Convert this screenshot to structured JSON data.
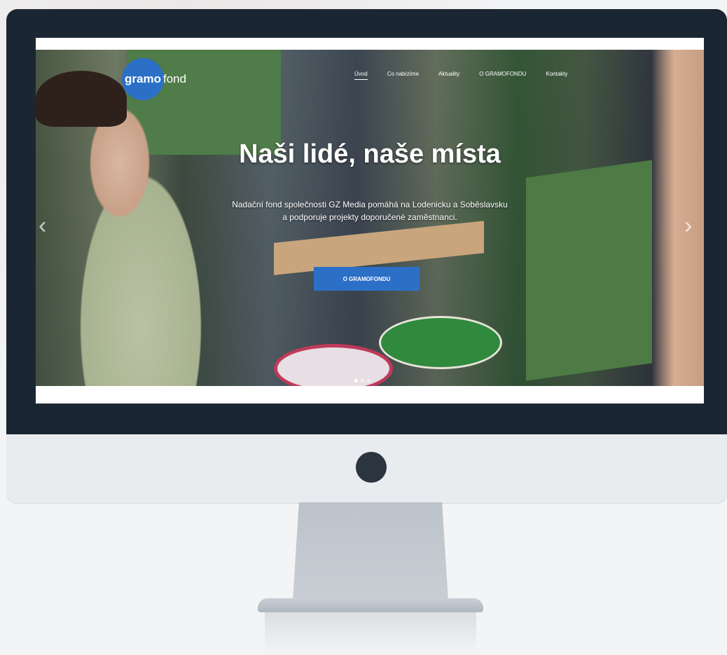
{
  "logo": {
    "part1": "gramo",
    "part2": "fond"
  },
  "nav": {
    "items": [
      {
        "label": "Úvod",
        "active": true
      },
      {
        "label": "Co nabízíme"
      },
      {
        "label": "Aktuality"
      },
      {
        "label": "O GRAMOFONDU"
      },
      {
        "label": "Kontakty"
      }
    ]
  },
  "hero": {
    "title": "Naši lidé, naše místa",
    "subtitle_line1": "Nadační fond společnosti GZ Media pomáhá na Lodenicku a Soběslavsku",
    "subtitle_line2": "a podporuje projekty doporučené zaměstnanci.",
    "cta_label": "O GRAMOFONDU",
    "prev_icon": "chevron-left-icon",
    "next_icon": "chevron-right-icon",
    "slides_count": 3,
    "active_slide": 1
  },
  "colors": {
    "brand_blue": "#2b6fc7",
    "bezel": "#1b2633",
    "chin": "#e9ecef"
  }
}
